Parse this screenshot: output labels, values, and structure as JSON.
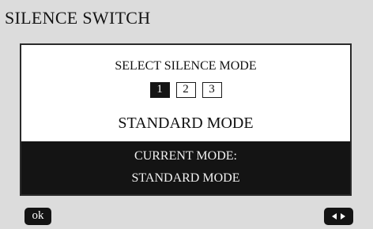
{
  "header": {
    "title": "SILENCE SWITCH"
  },
  "panel": {
    "select_label": "SELECT SILENCE MODE",
    "modes": [
      {
        "label": "1",
        "selected": true
      },
      {
        "label": "2",
        "selected": false
      },
      {
        "label": "3",
        "selected": false
      }
    ],
    "selected_mode_name": "STANDARD MODE",
    "current_mode_label": "CURRENT MODE:",
    "current_mode_value": "STANDARD MODE"
  },
  "footer": {
    "ok_label": "ok",
    "nav_icon": "left-right-arrows-icon"
  },
  "colors": {
    "background": "#dcdcdc",
    "panel": "#ffffff",
    "dark": "#141414",
    "light_text": "#f2f2f2"
  }
}
